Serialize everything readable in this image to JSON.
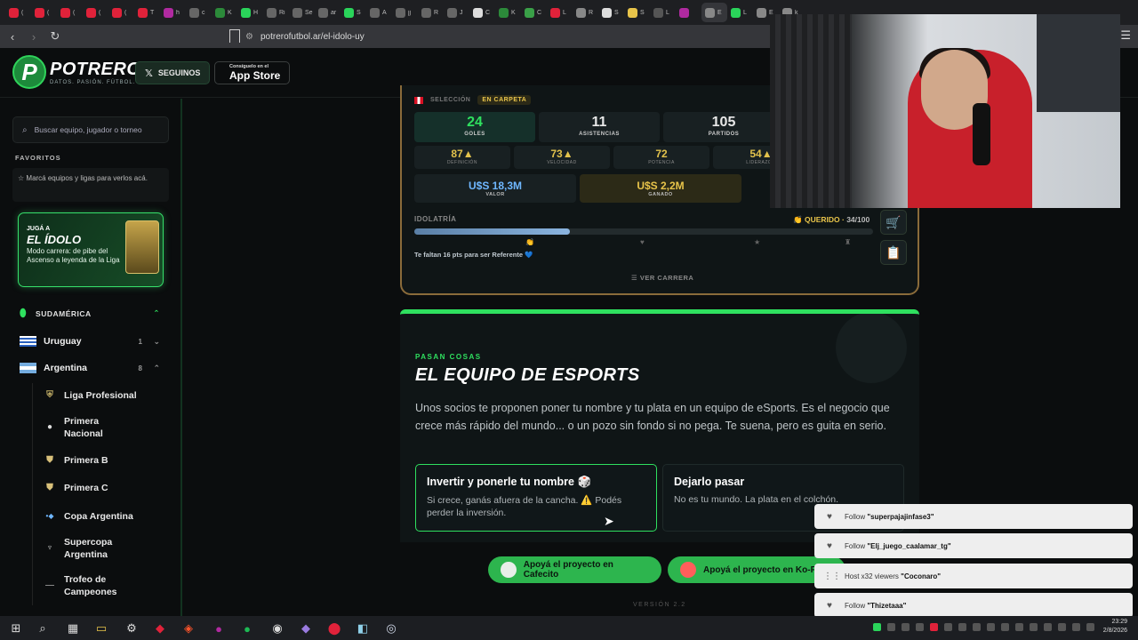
{
  "browser": {
    "url": "potrerofutbol.ar/el-idolo-uy",
    "tabs": [
      {
        "label": "(",
        "color": "#e0223a"
      },
      {
        "label": "(",
        "color": "#e0223a"
      },
      {
        "label": "(",
        "color": "#e0223a"
      },
      {
        "label": "(",
        "color": "#e0223a"
      },
      {
        "label": "(",
        "color": "#e0223a"
      },
      {
        "label": "T",
        "color": "#e0223a"
      },
      {
        "label": "h",
        "color": "#b02aa0"
      },
      {
        "label": "c",
        "color": "#666666"
      },
      {
        "label": "K",
        "color": "#2c8a3a"
      },
      {
        "label": "H",
        "color": "#2ad45a"
      },
      {
        "label": "Ri",
        "color": "#666666"
      },
      {
        "label": "Se",
        "color": "#666666"
      },
      {
        "label": "ar",
        "color": "#666666"
      },
      {
        "label": "S",
        "color": "#2ad45a"
      },
      {
        "label": "A",
        "color": "#666666"
      },
      {
        "label": "jj",
        "color": "#666666"
      },
      {
        "label": "R",
        "color": "#666666"
      },
      {
        "label": "J",
        "color": "#666666"
      },
      {
        "label": "C",
        "color": "#dddddd"
      },
      {
        "label": "K",
        "color": "#2c8a3a"
      },
      {
        "label": "C",
        "color": "#3aa048"
      },
      {
        "label": "L",
        "color": "#e0223a"
      },
      {
        "label": "R",
        "color": "#888888"
      },
      {
        "label": "S",
        "color": "#dddddd"
      },
      {
        "label": "S",
        "color": "#e8c44a"
      },
      {
        "label": "L",
        "color": "#555555"
      },
      {
        "label": "",
        "color": "#b02aa0"
      },
      {
        "label": "E",
        "color": "#888888"
      },
      {
        "label": "L",
        "color": "#2ad45a"
      },
      {
        "label": "E",
        "color": "#888888"
      },
      {
        "label": "k",
        "color": "#888888"
      }
    ]
  },
  "header": {
    "brand": "POTRERO",
    "tagline": "DATOS. PASIÓN. FÚTBOL.",
    "follow_label": "SEGUINOS",
    "appstore_small": "Consíguelo en el",
    "appstore_big": "App Store"
  },
  "sidebar": {
    "search_placeholder": "Buscar equipo, jugador o torneo",
    "favorites_title": "FAVORITOS",
    "favorites_hint": "Marcá equipos y ligas para verlos acá.",
    "promo": {
      "line1": "JUGÁ A",
      "line2": "EL ÍDOLO",
      "line3": "Modo carrera: de pibe del Ascenso a leyenda de la Liga"
    },
    "region": "SUDAMÉRICA",
    "countries": [
      {
        "name": "Uruguay",
        "count": "1",
        "chevron": "⌄"
      },
      {
        "name": "Argentina",
        "count": "8",
        "chevron": "⌃"
      }
    ],
    "leagues": [
      "Liga Profesional",
      "Primera Nacional",
      "Primera B",
      "Primera C",
      "Copa Argentina",
      "Supercopa Argentina",
      "Trofeo de Campeones"
    ]
  },
  "career": {
    "selection_label": "SELECCIÓN",
    "status_pill": "EN CARPETA",
    "stats": [
      {
        "value": "24",
        "label": "GOLES",
        "color": "#2fe05f"
      },
      {
        "value": "11",
        "label": "ASISTENCIAS",
        "color": "#ffffff"
      },
      {
        "value": "105",
        "label": "PARTIDOS",
        "color": "#ffffff"
      }
    ],
    "attributes": [
      {
        "value": "87▲",
        "label": "DEFINICIÓN"
      },
      {
        "value": "73▲",
        "label": "VELOCIDAD"
      },
      {
        "value": "72",
        "label": "POTENCIA"
      },
      {
        "value": "54▲",
        "label": "LIDERAZGO"
      }
    ],
    "money": [
      {
        "value": "U$S 18,3M",
        "label": "VALOR",
        "color": "#6fb7ff"
      },
      {
        "value": "U$S 2,2M",
        "label": "GANADO",
        "color": "#e8c44a"
      }
    ],
    "idolatry_label": "IDOLATRÍA",
    "idolatry_status": "QUERIDO",
    "idolatry_score": "34/100",
    "idolatry_fraction": 0.34,
    "idolatry_hint": "Te faltan 16 pts para ser Referente 💙",
    "career_link": "VER CARRERA"
  },
  "event": {
    "kicker": "PASAN COSAS",
    "title": "EL EQUIPO DE ESPORTS",
    "body": "Unos socios te proponen poner tu nombre y tu plata en un equipo de eSports. Es el negocio que crece más rápido del mundo... o un pozo sin fondo si no pega. Te suena, pero es guita en serio.",
    "choices": [
      {
        "title": "Invertir y ponerle tu nombre 🎲",
        "desc": "Si crece, ganás afuera de la cancha. ⚠️ Podés perder la inversión."
      },
      {
        "title": "Dejarlo pasar",
        "desc": "No es tu mundo. La plata en el colchón."
      }
    ]
  },
  "support": {
    "cafecito": "Apoyá el proyecto en Cafecito",
    "kofi": "Apoyá el proyecto en Ko-Fi"
  },
  "version": "VERSIÓN 2.2",
  "alerts": [
    {
      "prefix": "Follow",
      "name": "\"superpajajinfase3\"",
      "icon": "heart-icon"
    },
    {
      "prefix": "Follow",
      "name": "\"Elj_juego_caalamar_tg\"",
      "icon": "heart-icon"
    },
    {
      "prefix": "Host x32 viewers",
      "name": "\"Coconaro\"",
      "icon": "host-icon"
    },
    {
      "prefix": "Follow",
      "name": "\"Thizetaaa\"",
      "icon": "heart-icon"
    }
  ],
  "taskbar": {
    "time": "23:29",
    "date": "2/8/2026"
  }
}
